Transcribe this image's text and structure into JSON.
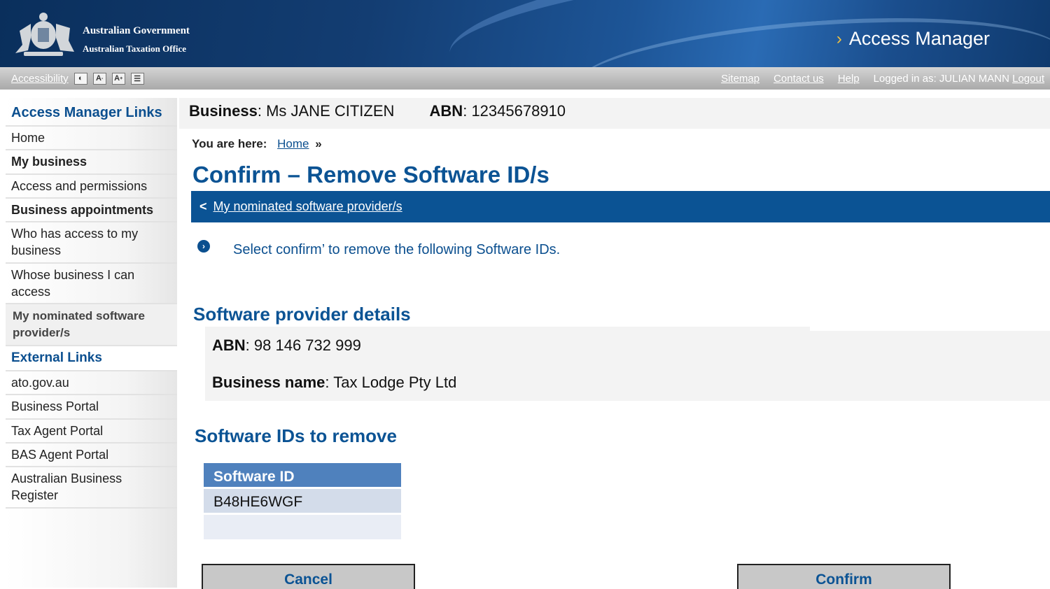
{
  "header": {
    "gov_line1": "Australian Government",
    "gov_line2": "Australian Taxation Office",
    "app_title": "Access Manager",
    "app_title_icon": "chevron-right-icon"
  },
  "utility_bar": {
    "accessibility_label": "Accessibility",
    "contrast_icon": "contrast-icon",
    "font_smaller_label": "A",
    "font_larger_label": "A",
    "print_icon": "print-icon",
    "links": [
      "Sitemap",
      "Contact us",
      "Help"
    ],
    "logged_in_prefix": "Logged in as: ",
    "logged_in_user": "JULIAN MANN",
    "logout_label": "Logout"
  },
  "sidebar": {
    "heading": "Access Manager Links",
    "items": [
      {
        "label": "Home"
      },
      {
        "label": "My business"
      },
      {
        "label": "Access and permissions"
      },
      {
        "label": "Business appointments"
      },
      {
        "label": "Who has access to my business"
      },
      {
        "label": "Whose business I can access"
      },
      {
        "label": "My nominated software provider/s"
      }
    ],
    "external_heading": "External Links",
    "external_items": [
      {
        "label": "ato.gov.au"
      },
      {
        "label": "Business Portal"
      },
      {
        "label": "Tax Agent Portal"
      },
      {
        "label": "BAS Agent Portal"
      },
      {
        "label": "Australian Business Register"
      }
    ]
  },
  "business": {
    "business_label": "Business",
    "business_value": "Ms JANE CITIZEN",
    "abn_label": "ABN",
    "abn_value": "12345678910"
  },
  "breadcrumb": {
    "prefix": "You are here:",
    "home": "Home",
    "separator": "»"
  },
  "page": {
    "title": "Confirm – Remove Software ID/s",
    "back_arrow": "<",
    "back_link": "My nominated software provider/s",
    "info_icon": "arrow-circle-icon",
    "info_text": "Select confirm’ to remove the following Software IDs."
  },
  "provider": {
    "section_title": "Software provider details",
    "abn_label": "ABN",
    "abn_value": "98 146 732 999",
    "name_label": "Business name",
    "name_value": "Tax Lodge Pty Ltd"
  },
  "software": {
    "section_title": "Software IDs to remove",
    "column_header": "Software ID",
    "rows": [
      "B48HE6WGF"
    ]
  },
  "actions": {
    "cancel_label": "Cancel",
    "confirm_label": "Confirm"
  }
}
